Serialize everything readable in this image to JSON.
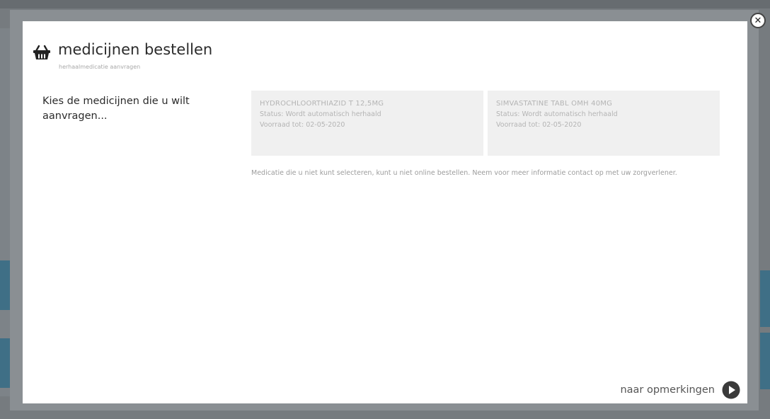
{
  "modal": {
    "title": "medicijnen bestellen",
    "subtitle": "herhaalmedicatie aanvragen",
    "intro": "Kies de medicijnen die u wilt aanvragen...",
    "close_symbol": "✕"
  },
  "medications": [
    {
      "name": "HYDROCHLOORTHIAZID T 12,5MG",
      "status": "Status: Wordt automatisch herhaald",
      "supply": "Voorraad tot: 02-05-2020"
    },
    {
      "name": "SIMVASTATINE TABL OMH 40MG",
      "status": "Status: Wordt automatisch herhaald",
      "supply": "Voorraad tot: 02-05-2020"
    }
  ],
  "note": "Medicatie die u niet kunt selecteren, kunt u niet online bestellen. Neem voor meer informatie contact op met uw zorgverlener.",
  "footer": {
    "next_label": "naar opmerkingen"
  },
  "icons": {
    "basket": "basket-icon",
    "close": "close-icon",
    "next": "arrow-right-circle-icon"
  }
}
